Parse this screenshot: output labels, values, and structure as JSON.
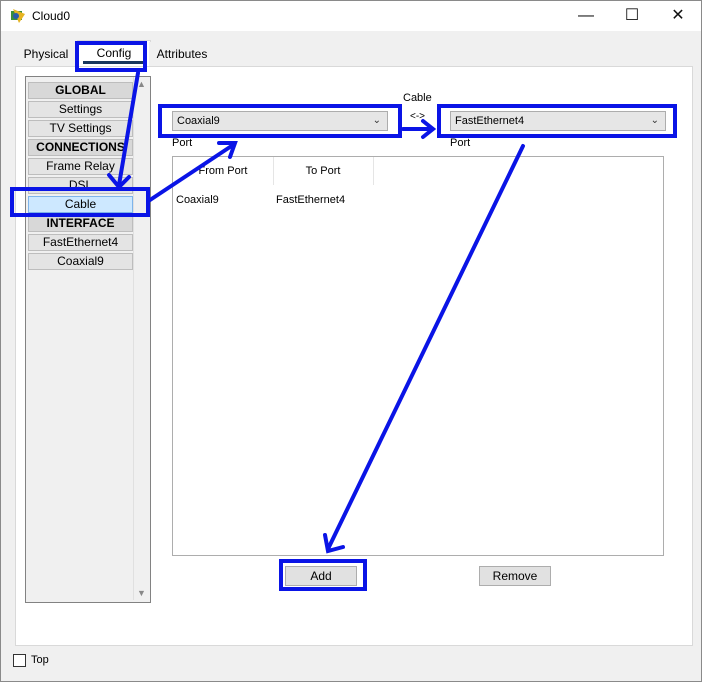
{
  "window": {
    "title": "Cloud0",
    "minimize": "—",
    "maximize": "☐",
    "close": "✕"
  },
  "tabs": [
    {
      "label": "Physical"
    },
    {
      "label": "Config"
    },
    {
      "label": "Attributes"
    }
  ],
  "sidebar": {
    "items": [
      {
        "label": "GLOBAL",
        "header": true
      },
      {
        "label": "Settings"
      },
      {
        "label": "TV Settings"
      },
      {
        "label": "CONNECTIONS",
        "header": true
      },
      {
        "label": "Frame Relay"
      },
      {
        "label": "DSL"
      },
      {
        "label": "Cable",
        "selected": true
      },
      {
        "label": "INTERFACE",
        "header": true
      },
      {
        "label": "FastEthernet4"
      },
      {
        "label": "Coaxial9"
      }
    ]
  },
  "cable": {
    "heading": "Cable",
    "arrow_symbol": "<->",
    "from_select": {
      "value": "Coaxial9"
    },
    "to_select": {
      "value": "FastEthernet4"
    },
    "from_label": "Port",
    "to_label": "Port"
  },
  "table": {
    "columns": [
      "From Port",
      "To Port"
    ],
    "rows": [
      {
        "from": "Coaxial9",
        "to": "FastEthernet4"
      }
    ]
  },
  "buttons": {
    "add": "Add",
    "remove": "Remove"
  },
  "footer": {
    "top_label": "Top"
  },
  "colors": {
    "annotation": "#0a14e6",
    "selected_item": "#cde8ff",
    "config_underline": "#17365d"
  }
}
